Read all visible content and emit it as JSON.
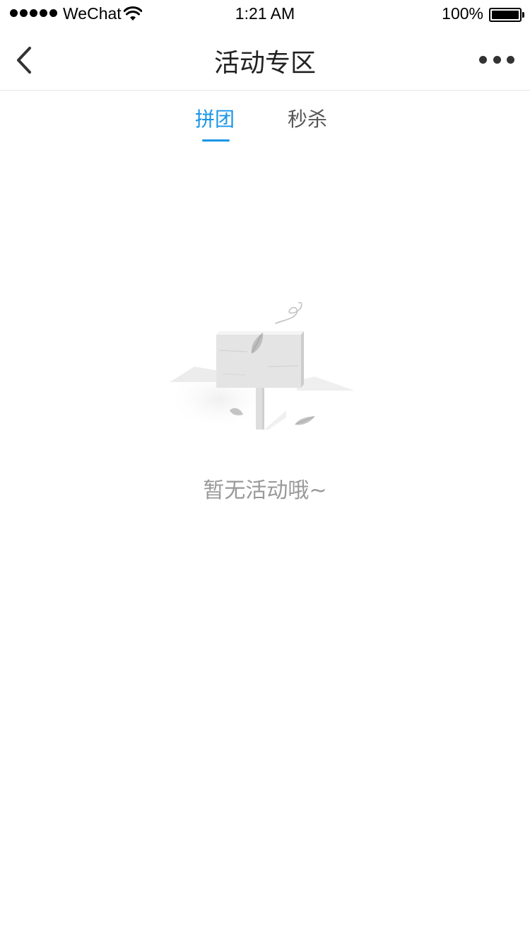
{
  "status_bar": {
    "carrier": "WeChat",
    "time": "1:21 AM",
    "battery": "100%"
  },
  "nav": {
    "title": "活动专区",
    "back_icon": "chevron-left-icon",
    "more_icon": "more-dots-icon"
  },
  "tabs": [
    {
      "label": "拼团",
      "active": true
    },
    {
      "label": "秒杀",
      "active": false
    }
  ],
  "empty_state": {
    "icon": "empty-signpost-icon",
    "message": "暂无活动哦~"
  },
  "colors": {
    "accent": "#1a95e8",
    "muted_text": "#999999"
  }
}
